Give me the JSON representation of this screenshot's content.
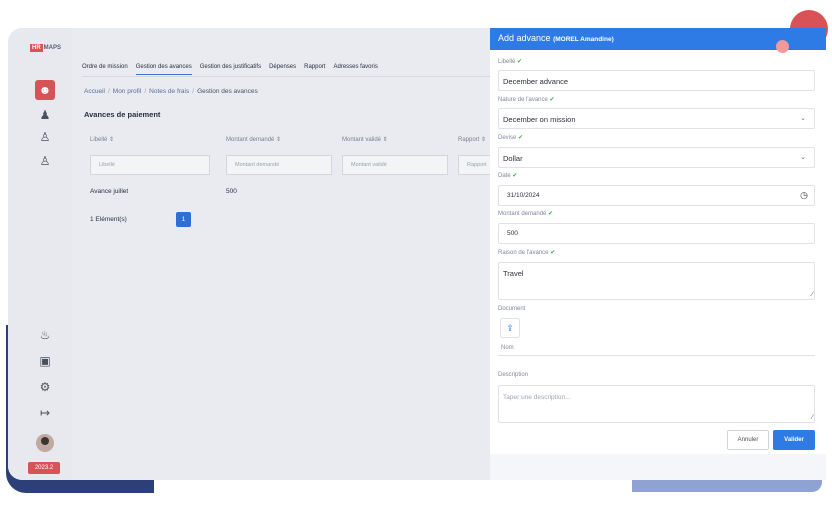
{
  "logo": {
    "hr": "HR",
    "maps": "MAPS"
  },
  "sidebar": {
    "version": "2023.2"
  },
  "tabs": [
    "Ordre de mission",
    "Gestion des avances",
    "Gestion des justificatifs",
    "Dépenses",
    "Rapport",
    "Adresses favoris"
  ],
  "breadcrumb": [
    "Accueil",
    "Mon profil",
    "Notes de frais",
    "Gestion des avances"
  ],
  "section_title": "Avances de paiement",
  "table": {
    "headers": [
      "Libellé ⇕",
      "Montant demandé ⇕",
      "Montant validé ⇕",
      "Rapport ⇕"
    ],
    "filters": [
      "Libellé",
      "Montant demandé",
      "Montant validé",
      "Rapport"
    ],
    "row": {
      "libelle": "Avance juillet",
      "montant": "500"
    }
  },
  "pagination": {
    "count": "1 Elément(s)",
    "page": "1"
  },
  "dialog": {
    "title": "Add advance",
    "subtitle": "(MOREL Amandine)",
    "fields": {
      "libelle": {
        "label": "Libellé",
        "value": "December advance"
      },
      "nature": {
        "label": "Nature de l'avance",
        "value": "December on mission"
      },
      "devise": {
        "label": "Devise",
        "value": "Dollar"
      },
      "date": {
        "label": "Date",
        "value": "31/10/2024"
      },
      "montant": {
        "label": "Montant demandé",
        "value": "500"
      },
      "raison": {
        "label": "Raison de l'avance",
        "value": "Travel"
      },
      "document": {
        "label": "Document",
        "nom": "Nom"
      },
      "description": {
        "label": "Description",
        "placeholder": "Taper une description..."
      }
    },
    "buttons": {
      "cancel": "Annuler",
      "ok": "Valider"
    }
  }
}
